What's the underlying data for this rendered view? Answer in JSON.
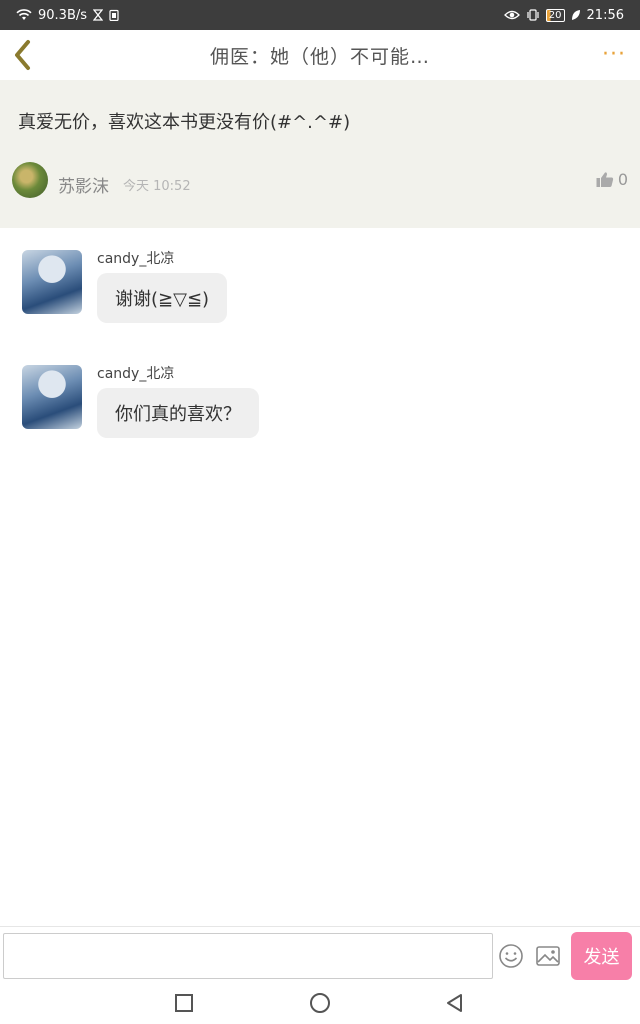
{
  "status_bar": {
    "network_speed": "90.3B/s",
    "battery_level": "20",
    "time": "21:56"
  },
  "header": {
    "title": "佣医：她（他）不可能…",
    "more_label": "···"
  },
  "post": {
    "content": "真爱无价，喜欢这本书更没有价(#^.^#)",
    "author": "苏影沫",
    "time": "今天 10:52",
    "likes": "0"
  },
  "replies": [
    {
      "author": "candy_北凉",
      "text": "谢谢(≧▽≦)"
    },
    {
      "author": "candy_北凉",
      "text": "你们真的喜欢？"
    }
  ],
  "input": {
    "value": "",
    "placeholder": "",
    "send_label": "发送"
  },
  "colors": {
    "accent": "#e8a23a",
    "send_button": "#f77fa8",
    "post_background": "#f2f2ec",
    "bubble": "#efefef"
  },
  "icons": {
    "back": "chevron-left-icon",
    "more": "more-dots-icon",
    "like": "thumbs-up-icon",
    "emoji": "smiley-icon",
    "image": "image-icon",
    "nav_recent": "square-icon",
    "nav_home": "circle-icon",
    "nav_back": "triangle-back-icon"
  }
}
